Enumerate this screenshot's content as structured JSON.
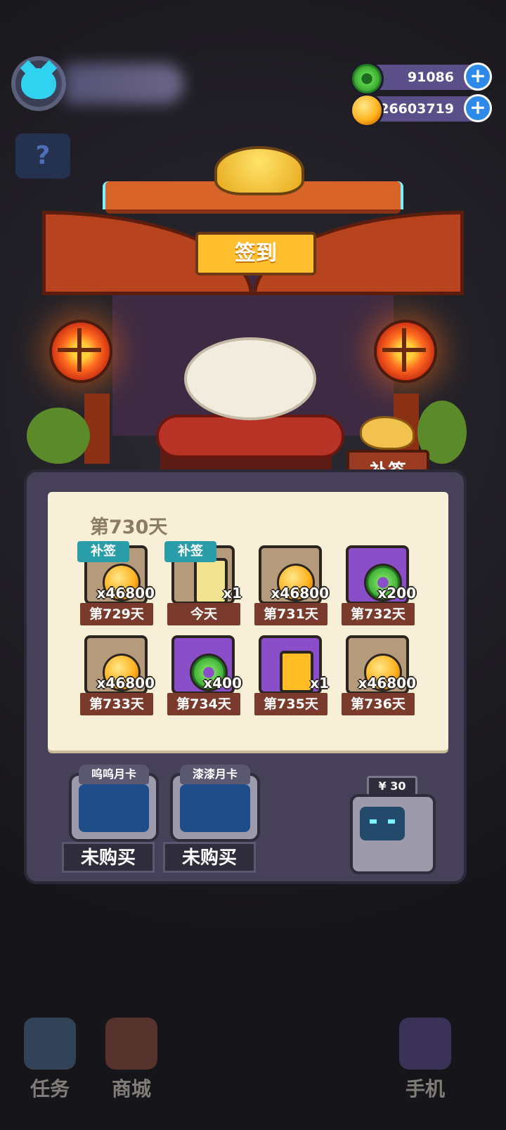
{
  "hud": {
    "gem_value": "91086",
    "coin_value": "26603719",
    "plus_symbol": "+",
    "question_symbol": "?"
  },
  "gate": {
    "sign_label": "签到",
    "makeup_button_label": "补签"
  },
  "checkin": {
    "title": "第730天",
    "tag_label": "补签",
    "days": [
      {
        "label": "第729天",
        "qty": "x46800",
        "reward": "coin",
        "tag": true
      },
      {
        "label": "今天",
        "qty": "x1",
        "reward": "trophy",
        "tag": true
      },
      {
        "label": "第731天",
        "qty": "x46800",
        "reward": "coin",
        "tag": false
      },
      {
        "label": "第732天",
        "qty": "x200",
        "reward": "gem",
        "tag": false
      },
      {
        "label": "第733天",
        "qty": "x46800",
        "reward": "coin",
        "tag": false
      },
      {
        "label": "第734天",
        "qty": "x400",
        "reward": "gem",
        "tag": false
      },
      {
        "label": "第735天",
        "qty": "x1",
        "reward": "battery",
        "tag": false
      },
      {
        "label": "第736天",
        "qty": "x46800",
        "reward": "coin",
        "tag": false
      }
    ]
  },
  "monthly": {
    "card1_title": "呜呜月卡",
    "card2_title": "漆漆月卡",
    "status": "未购买",
    "price": "¥ 30"
  },
  "nav": {
    "tasks": "任务",
    "shop": "商城",
    "phone": "手机"
  }
}
